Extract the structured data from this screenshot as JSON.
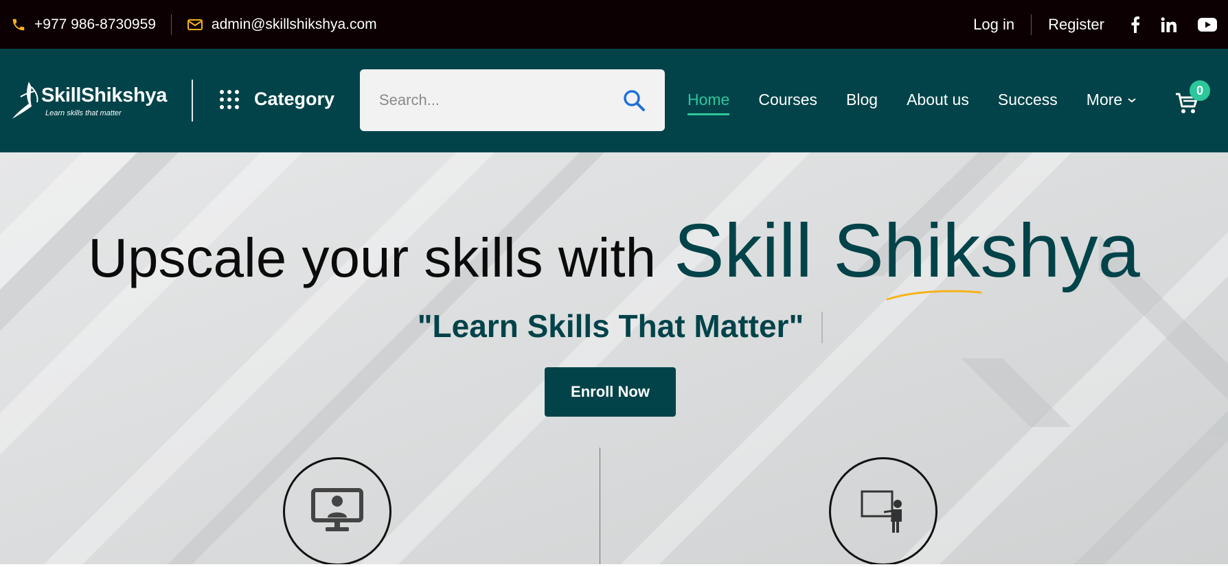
{
  "topbar": {
    "phone": "+977 986-8730959",
    "email": "admin@skillshikshya.com",
    "login": "Log in",
    "register": "Register",
    "social": [
      "facebook-icon",
      "linkedin-icon",
      "youtube-icon"
    ]
  },
  "logo": {
    "name": "SkillShikshya",
    "tagline": "Learn skills that matter"
  },
  "nav": {
    "category": "Category",
    "search_placeholder": "Search...",
    "menu": [
      {
        "label": "Home",
        "active": true
      },
      {
        "label": "Courses"
      },
      {
        "label": "Blog"
      },
      {
        "label": "About us"
      },
      {
        "label": "Success"
      }
    ],
    "more": "More",
    "cart_count": "0"
  },
  "hero": {
    "headline": "Upscale your skills with",
    "brand": "Skill Shikshya",
    "subtitle": "\"Learn Skills That Matter\"",
    "cta": "Enroll Now",
    "features": [
      "online-class-icon",
      "classroom-trainer-icon"
    ]
  },
  "colors": {
    "topbar_bg": "#0d0002",
    "nav_bg": "#014349",
    "accent": "#2cc79a",
    "icon_yellow": "#f5b21b",
    "search_icon": "#1f6fd6"
  }
}
